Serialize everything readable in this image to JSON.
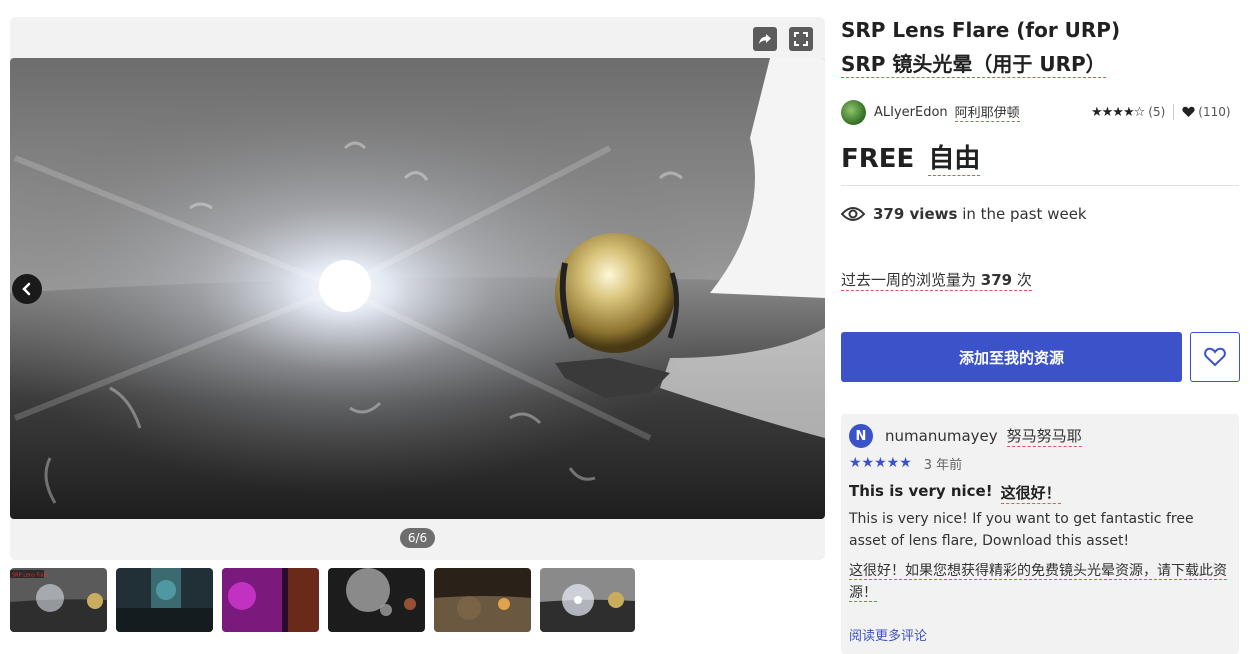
{
  "gallery": {
    "counter": "6/6",
    "share_icon": "share-icon",
    "fullscreen_icon": "fullscreen-icon",
    "prev_icon": "chevron-left-icon",
    "thumb_label": "SRP Lens Flare"
  },
  "product": {
    "title": "SRP Lens Flare (for URP)",
    "title_translated": "SRP 镜头光晕（用于 URP）",
    "publisher": "ALIyerEdon",
    "publisher_translated": "阿利耶伊顿",
    "rating_stars": "★★★★☆",
    "rating_count": "(5)",
    "favorites": "(110)",
    "price": "FREE",
    "price_translated": "自由",
    "views_count": "379 views",
    "views_suffix": " in the past week",
    "views_translated_prefix": "过去一周的浏览量为 ",
    "views_translated_count": "379",
    "views_translated_suffix": " 次",
    "add_button": "添加至我的资源",
    "accent_color": "#3c52c8"
  },
  "review": {
    "avatar_letter": "N",
    "user": "numanumayey",
    "user_translated": "努马努马耶",
    "stars": "★★★★★",
    "time": "3 年前",
    "title": "This is very nice!",
    "title_translated": "这很好！",
    "body": "This is very nice! If you want to get fantastic free asset of lens flare, Download this asset!",
    "body_translated": "这很好！如果您想获得精彩的免费镜头光晕资源，请下载此资源！",
    "read_more": "阅读更多评论"
  }
}
